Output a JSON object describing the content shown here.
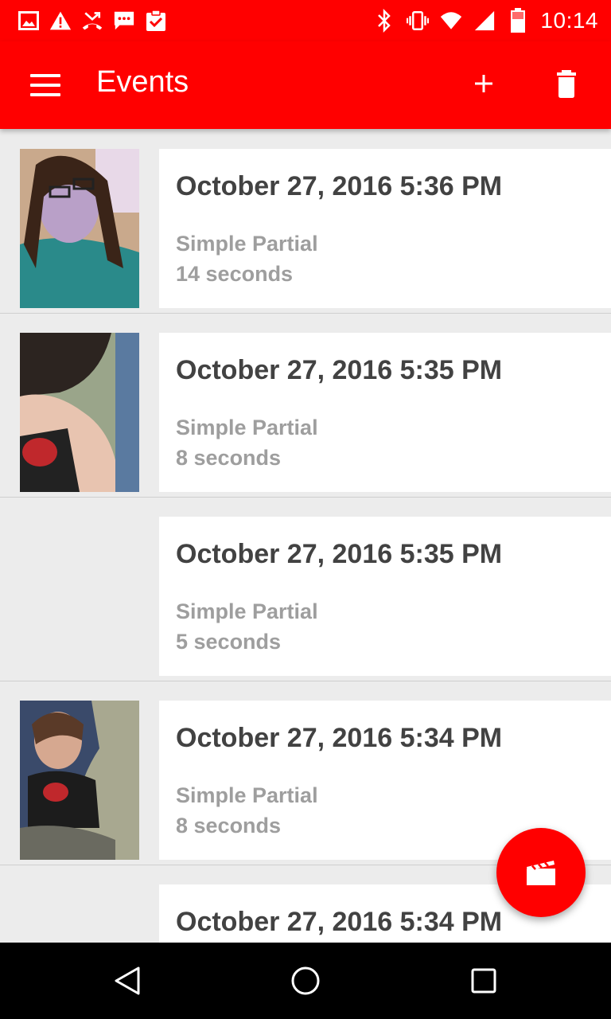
{
  "status_bar": {
    "time": "10:14",
    "left_icons": [
      "image-icon",
      "warning-icon",
      "missed-call-icon",
      "sms-icon",
      "clipboard-check-icon"
    ],
    "right_icons": [
      "bluetooth-icon",
      "vibrate-icon",
      "wifi-icon",
      "cell-signal-icon",
      "battery-icon"
    ]
  },
  "app_bar": {
    "title": "Events",
    "accent_color": "#ff0000"
  },
  "events": [
    {
      "date": "October 27, 2016 5:36 PM",
      "type": "Simple Partial",
      "duration": "14 seconds",
      "has_thumbnail": true
    },
    {
      "date": "October 27, 2016 5:35 PM",
      "type": "Simple Partial",
      "duration": "8 seconds",
      "has_thumbnail": true
    },
    {
      "date": "October 27, 2016 5:35 PM",
      "type": "Simple Partial",
      "duration": "5 seconds",
      "has_thumbnail": false
    },
    {
      "date": "October 27, 2016 5:34 PM",
      "type": "Simple Partial",
      "duration": "8 seconds",
      "has_thumbnail": true
    },
    {
      "date": "October 27, 2016 5:34 PM",
      "type": "",
      "duration": "",
      "has_thumbnail": false
    }
  ],
  "fab": {
    "icon": "clapperboard-icon"
  },
  "nav_bar": {
    "icons": [
      "back-icon",
      "home-icon",
      "recents-icon"
    ]
  }
}
